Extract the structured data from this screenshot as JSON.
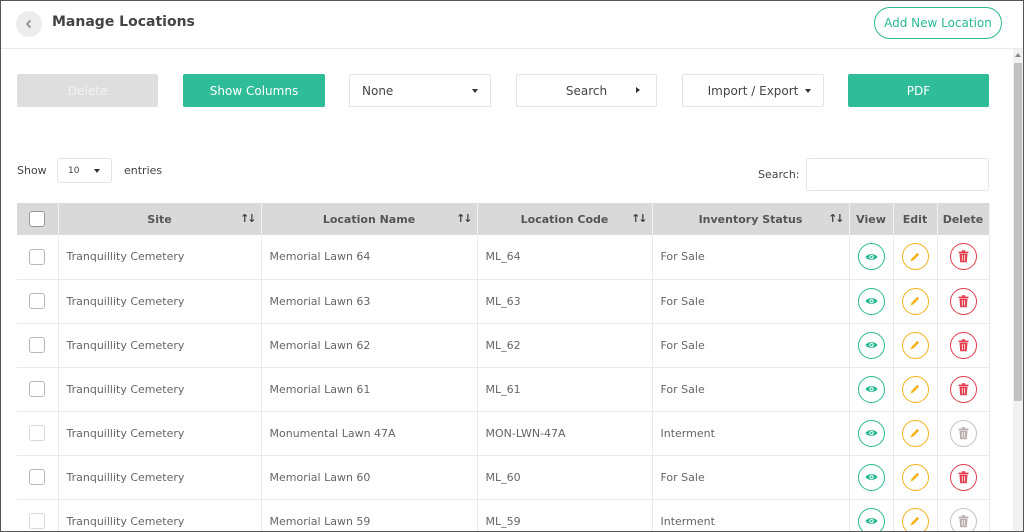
{
  "header": {
    "title": "Manage Locations",
    "add_label": "Add New Location"
  },
  "toolbar": {
    "delete_label": "Delete",
    "show_columns_label": "Show Columns",
    "filter_value": "None",
    "search_label": "Search",
    "import_export_label": "Import / Export",
    "pdf_label": "PDF"
  },
  "entries": {
    "show_label": "Show",
    "value": "10",
    "entries_label": "entries"
  },
  "search": {
    "label": "Search:",
    "value": ""
  },
  "table": {
    "columns": [
      "Site",
      "Location Name",
      "Location Code",
      "Inventory Status",
      "View",
      "Edit",
      "Delete"
    ],
    "rows": [
      {
        "site": "Tranquillity Cemetery",
        "name": "Memorial Lawn 64",
        "code": "ML_64",
        "status": "For Sale"
      },
      {
        "site": "Tranquillity Cemetery",
        "name": "Memorial Lawn 63",
        "code": "ML_63",
        "status": "For Sale"
      },
      {
        "site": "Tranquillity Cemetery",
        "name": "Memorial Lawn 62",
        "code": "ML_62",
        "status": "For Sale"
      },
      {
        "site": "Tranquillity Cemetery",
        "name": "Memorial Lawn 61",
        "code": "ML_61",
        "status": "For Sale"
      },
      {
        "site": "Tranquillity Cemetery",
        "name": "Monumental Lawn 47A",
        "code": "MON-LWN-47A",
        "status": "Interment"
      },
      {
        "site": "Tranquillity Cemetery",
        "name": "Memorial Lawn 60",
        "code": "ML_60",
        "status": "For Sale"
      },
      {
        "site": "Tranquillity Cemetery",
        "name": "Memorial Lawn 59",
        "code": "ML_59",
        "status": "Interment"
      }
    ]
  },
  "colors": {
    "accent": "#2fbc99",
    "view": "#2bb895",
    "edit": "#f3b21b",
    "delete": "#e23d4c",
    "disabled_delete": "#b9aeae"
  },
  "icons": {
    "back": "chevron-left-icon",
    "view": "eye-icon",
    "edit": "pencil-icon",
    "delete": "trash-icon",
    "sort": "sort-arrows-icon"
  }
}
